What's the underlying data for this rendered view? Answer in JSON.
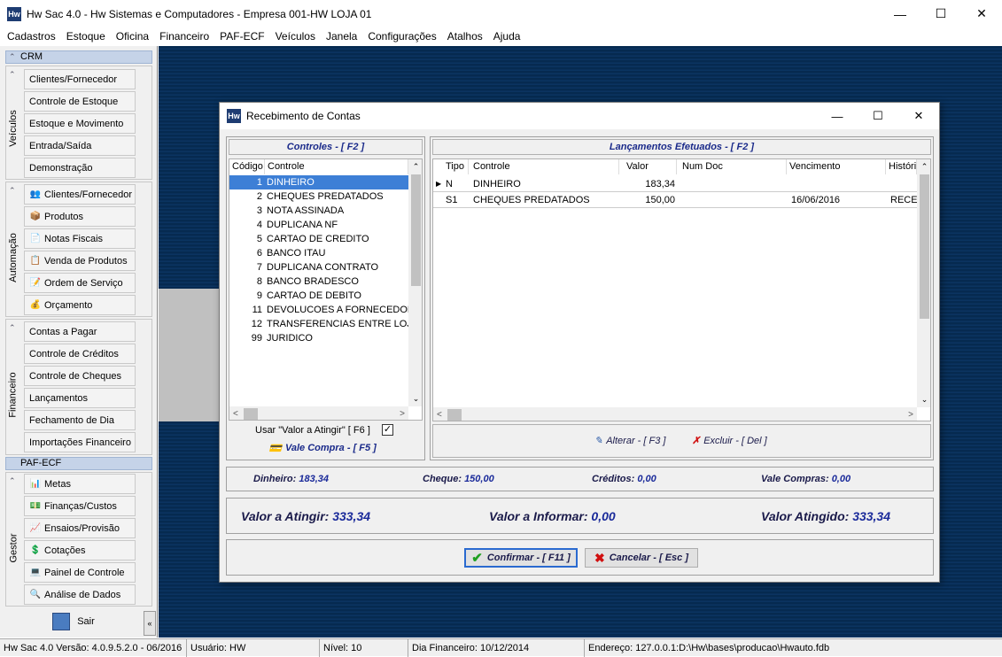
{
  "window": {
    "title": "Hw Sac 4.0 - Hw Sistemas e Computadores - Empresa 001-HW LOJA 01",
    "logo": "Hw"
  },
  "menu": [
    "Cadastros",
    "Estoque",
    "Oficina",
    "Financeiro",
    "PAF-ECF",
    "Veículos",
    "Janela",
    "Configurações",
    "Atalhos",
    "Ajuda"
  ],
  "sidebar": {
    "crm": "CRM",
    "veiculos": {
      "label": "Veículos",
      "items": [
        "Clientes/Fornecedor",
        "Controle de Estoque",
        "Estoque e Movimento",
        "Entrada/Saída",
        "Demonstração"
      ]
    },
    "automacao": {
      "label": "Automação",
      "items": [
        "Clientes/Fornecedor",
        "Produtos",
        "Notas Fiscais",
        "Venda de Produtos",
        "Ordem de Serviço",
        "Orçamento"
      ]
    },
    "financeiro": {
      "label": "Financeiro",
      "items": [
        "Contas a Pagar",
        "Controle de Créditos",
        "Controle de Cheques",
        "Lançamentos",
        "Fechamento de Dia",
        "Importações Financeiro"
      ]
    },
    "paf": "PAF-ECF",
    "gestor": {
      "label": "Gestor",
      "items": [
        "Metas",
        "Finanças/Custos",
        "Ensaios/Provisão",
        "Cotações",
        "Painel de Controle",
        "Análise de Dados"
      ]
    },
    "sair": "Sair",
    "collapse": "«"
  },
  "dialog": {
    "title": "Recebimento de Contas",
    "logo": "Hw",
    "controles": {
      "header": "Controles - [ F2 ]",
      "columns": [
        "Código",
        "Controle"
      ],
      "rows": [
        [
          "1",
          "DINHEIRO"
        ],
        [
          "2",
          "CHEQUES PREDATADOS"
        ],
        [
          "3",
          "NOTA ASSINADA"
        ],
        [
          "4",
          "DUPLICANA NF"
        ],
        [
          "5",
          "CARTAO DE CREDITO"
        ],
        [
          "6",
          "BANCO ITAU"
        ],
        [
          "7",
          "DUPLICANA CONTRATO"
        ],
        [
          "8",
          "BANCO BRADESCO"
        ],
        [
          "9",
          "CARTAO DE DEBITO"
        ],
        [
          "11",
          "DEVOLUCOES A FORNECEDOF"
        ],
        [
          "12",
          "TRANSFERENCIAS ENTRE LOJ"
        ],
        [
          "99",
          "JURIDICO"
        ]
      ],
      "usar_valor": "Usar \"Valor a Atingir\" [ F6 ]",
      "vale_compra": "Vale Compra - [ F5 ]"
    },
    "lancamentos": {
      "header": "Lançamentos Efetuados  - [ F2 ]",
      "columns": [
        "Tipo",
        "Controle",
        "Valor",
        "Num Doc",
        "Vencimento",
        "Históri"
      ],
      "rows": [
        [
          "N",
          "DINHEIRO",
          "183,34",
          "",
          "",
          ""
        ],
        [
          "S1",
          "CHEQUES PREDATADOS",
          "150,00",
          "",
          "16/06/2016",
          "RECE"
        ]
      ],
      "alterar": "Alterar - [ F3 ]",
      "excluir": "Excluir - [ Del ]"
    },
    "totals": {
      "dinheiro_label": "Dinheiro:",
      "dinheiro": "183,34",
      "cheque_label": "Cheque:",
      "cheque": "150,00",
      "creditos_label": "Créditos:",
      "creditos": "0,00",
      "vale_label": "Vale Compras:",
      "vale": "0,00"
    },
    "valores": {
      "atingir_label": "Valor a Atingir:",
      "atingir": "333,34",
      "informar_label": "Valor a Informar:",
      "informar": "0,00",
      "atingido_label": "Valor Atingido:",
      "atingido": "333,34"
    },
    "confirmar": "Confirmar - [ F11 ]",
    "cancelar": "Cancelar - [ Esc ]"
  },
  "status": {
    "versao": "Hw Sac 4.0 Versão: 4.0.9.5.2.0 - 06/2016",
    "usuario": "Usuário: HW",
    "nivel": "Nível: 10",
    "dia": "Dia Financeiro: 10/12/2014",
    "endereco": "Endereço: 127.0.0.1:D:\\Hw\\bases\\producao\\Hwauto.fdb"
  }
}
